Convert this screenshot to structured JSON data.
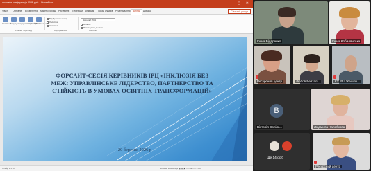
{
  "window": {
    "title": "форсайт-конференція 2026.pptx – PowerPoint",
    "controls": "–  ▢  ✕",
    "brand_color": "#c43e1c"
  },
  "ribbon_tabs": [
    "Файл",
    "Основне",
    "Вставлення",
    "Макет сторінки",
    "Рисування",
    "Переходи",
    "Анімація",
    "Показ слайдів",
    "Рецензування",
    "Вигляд",
    "Довідка"
  ],
  "share_button": "Спільний доступ",
  "ribbon": {
    "buttons": [
      "Звичайний",
      "Структура",
      "Сортувальник слайдів",
      "Сторінки нотаток",
      "Режим читання"
    ],
    "checks": [
      "Відображати лінійку",
      "Лінії сітки",
      "Напрямні"
    ],
    "checks2": [
      "Нотатки",
      "Масштаб",
      "Припасувати до вікна"
    ],
    "zoom_value": "Масштаб: 70%",
    "groups": [
      "Режими перегляду",
      "Відображення",
      "Масштаб"
    ]
  },
  "slide": {
    "title": "ФОРСАЙТ-СЕСІЯ КЕРІВНИКІВ ІРЦ «ІНКЛЮЗІЯ БЕЗ МЕЖ: УПРАВЛІНСЬКЕ ЛІДЕРСТВО, ПАРТНЕРСТВО ТА СТІЙКІСТЬ В УМОВАХ ОСВІТНІХ ТРАНСФОРМАЦІЙ»",
    "date": "20 березня 2026 р"
  },
  "statusbar": {
    "left": "Слайд 1 з 12",
    "right": "Нотатки   Коментарі   ▦  ▤  ▣   ───●─── 70%"
  },
  "gallery": {
    "participants": [
      {
        "name": "Ірина Бідаренко",
        "muted": false
      },
      {
        "name": "Ірина Кобилянська",
        "muted": false
      },
      {
        "name": "Ресурсний центр",
        "muted": true
      },
      {
        "name": "Любов Бевтал...",
        "muted": false
      },
      {
        "name": "КУ ІРЦ Жашків...",
        "muted": true
      },
      {
        "name": "Вікторія Сопіль...",
        "muted": false
      },
      {
        "name": "Людмила Чалабкова",
        "muted": false
      },
      {
        "name": "Ресурсний центр",
        "muted": true
      }
    ],
    "avatar_letter": "В",
    "mini_avatar_letter": "Н",
    "more_label": "Ще 14 осіб"
  }
}
